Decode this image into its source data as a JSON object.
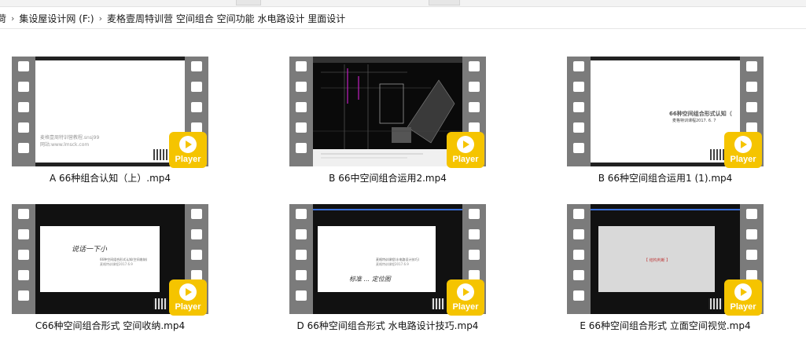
{
  "breadcrumb": {
    "items": [
      "菏",
      "集设屋设计网 (F:)",
      "麦格壹周特训营 空间组合 空间功能 水电路设计 里面设计"
    ],
    "separator": "›"
  },
  "videos": [
    {
      "filename": "A 66种组合认知（上）.mp4",
      "badge": "Player",
      "slide_text": "麦格壹周特训营教程.snsj99\n网站:www.lmsck.com"
    },
    {
      "filename": "B 66中空间组合运用2.mp4",
      "badge": "Player"
    },
    {
      "filename": "B 66种空间组合运用1 (1).mp4",
      "badge": "Player",
      "slide_title": "66种空间组合形式认知（",
      "slide_sub": "麦格特训课程2017. 6. 7"
    },
    {
      "filename": "C66种空间组合形式  空间收纳.mp4",
      "badge": "Player",
      "slide_hand": "说话一下小",
      "slide_title": "66种空间组合形式认知(空间收纳)",
      "slide_sub": "麦格特训课程2017.6.9"
    },
    {
      "filename": "D 66种空间组合形式 水电路设计技巧.mp4",
      "badge": "Player",
      "slide_title": "麦格特训课程(水电路设计技巧)",
      "slide_sub": "麦格特训课程2017.6.9",
      "slide_hand": "标准 ... 定位图"
    },
    {
      "filename": "E 66种空间组合形式  立面空间视觉.mp4",
      "badge": "Player",
      "slide_title": "【 结构判断 】"
    }
  ],
  "colors": {
    "badge": "#f5c400",
    "film": "#7b7b7b"
  }
}
